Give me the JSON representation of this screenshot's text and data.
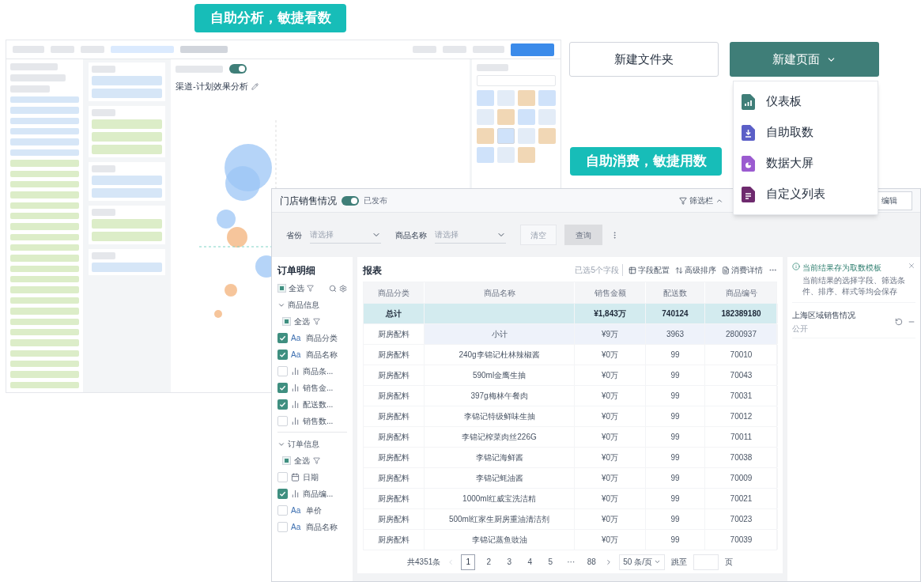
{
  "badges": [
    {
      "label": "自助分析，敏捷看数"
    },
    {
      "label": "自助消费，敏捷用数"
    }
  ],
  "editor": {
    "title": "渠道-计划效果分析",
    "toggle_on": true
  },
  "actions": {
    "folder_button": "新建文件夹",
    "page_button": "新建页面",
    "menu_open": true,
    "menu": [
      {
        "label": "仪表板",
        "color": "#3f7e78",
        "kind": "chart"
      },
      {
        "label": "自助取数",
        "color": "#5b5fc7",
        "kind": "download"
      },
      {
        "label": "数据大屏",
        "color": "#9b5bd0",
        "kind": "pie"
      },
      {
        "label": "自定义列表",
        "color": "#6e2a6e",
        "kind": "list"
      }
    ]
  },
  "report_window": {
    "title": "门店销售情况",
    "published": true,
    "status": "已发布",
    "filter_toggle": "筛选栏",
    "edit_button": "编辑",
    "filters": [
      {
        "label": "省份",
        "placeholder": "请选择"
      },
      {
        "label": "商品名称",
        "placeholder": "请选择"
      }
    ],
    "clear_button": "清空",
    "query_button": "查询",
    "field_panel": {
      "title": "订单明细",
      "select_all": {
        "label": "全选",
        "indeterminate": true
      },
      "groups": [
        {
          "label": "商品信息",
          "expanded": true,
          "select_all": {
            "label": "全选",
            "indeterminate": true
          },
          "fields": [
            {
              "kind": "text",
              "icon_text": "Aa",
              "label": "商品分类",
              "checked": true
            },
            {
              "kind": "text",
              "icon_text": "Aa",
              "label": "商品名称",
              "checked": true
            },
            {
              "kind": "measure",
              "label": "商品条...",
              "checked": false
            },
            {
              "kind": "measure",
              "label": "销售金...",
              "checked": true
            },
            {
              "kind": "measure",
              "label": "配送数...",
              "checked": true
            },
            {
              "kind": "measure",
              "label": "销售数...",
              "checked": false
            }
          ]
        },
        {
          "label": "订单信息",
          "expanded": true,
          "select_all": {
            "label": "全选",
            "indeterminate": true
          },
          "fields": [
            {
              "kind": "date",
              "label": "日期",
              "checked": false
            },
            {
              "kind": "measure",
              "label": "商品编...",
              "checked": true
            },
            {
              "kind": "text",
              "icon_text": "Aa",
              "label": "单价",
              "checked": false
            },
            {
              "kind": "text",
              "icon_text": "Aa",
              "label": "商品名称",
              "checked": false
            }
          ]
        }
      ]
    },
    "report": {
      "title": "报表",
      "selected_count": "已选5个字段",
      "tools": [
        "字段配置",
        "高级排序",
        "消费详情"
      ],
      "columns": [
        "商品分类",
        "商品名称",
        "销售金额",
        "配送数",
        "商品编号"
      ],
      "rows": [
        {
          "kind": "total",
          "cells": [
            "总计",
            "",
            "¥1,843万",
            "740124",
            "182389180"
          ]
        },
        {
          "kind": "subtotal",
          "cells": [
            "厨房配料",
            "小计",
            "¥9万",
            "3963",
            "2800937"
          ]
        },
        {
          "kind": "row",
          "cells": [
            "厨房配料",
            "240g李锦记杜林辣椒酱",
            "¥0万",
            "99",
            "70010"
          ]
        },
        {
          "kind": "row",
          "cells": [
            "厨房配料",
            "590ml金鹰生抽",
            "¥0万",
            "99",
            "70043"
          ]
        },
        {
          "kind": "row",
          "cells": [
            "厨房配料",
            "397g梅林午餐肉",
            "¥0万",
            "99",
            "70031"
          ]
        },
        {
          "kind": "row",
          "cells": [
            "厨房配料",
            "李锦记特级鲜味生抽",
            "¥0万",
            "99",
            "70012"
          ]
        },
        {
          "kind": "row",
          "cells": [
            "厨房配料",
            "李锦记榨菜肉丝226G",
            "¥0万",
            "99",
            "70011"
          ]
        },
        {
          "kind": "row",
          "cells": [
            "厨房配料",
            "李锦记海鲜酱",
            "¥0万",
            "99",
            "70038"
          ]
        },
        {
          "kind": "row",
          "cells": [
            "厨房配料",
            "李锦记蚝油酱",
            "¥0万",
            "99",
            "70009"
          ]
        },
        {
          "kind": "row",
          "cells": [
            "厨房配料",
            "1000ml红威宝洗洁精",
            "¥0万",
            "99",
            "70021"
          ]
        },
        {
          "kind": "row",
          "cells": [
            "厨房配料",
            "500ml红家生厨房重油清洁剂",
            "¥0万",
            "99",
            "70023"
          ]
        },
        {
          "kind": "row",
          "cells": [
            "厨房配料",
            "李锦记蒸鱼豉油",
            "¥0万",
            "99",
            "70039"
          ]
        }
      ],
      "pagination": {
        "total": "共4351条",
        "pages": [
          {
            "label": "1",
            "selected": true
          },
          {
            "label": "2",
            "selected": false
          },
          {
            "label": "3",
            "selected": false
          },
          {
            "label": "4",
            "selected": false
          },
          {
            "label": "5",
            "selected": false
          },
          {
            "label": "···",
            "selected": false
          },
          {
            "label": "88",
            "selected": false
          }
        ],
        "page_size": "50 条/页",
        "jump_label": "跳至",
        "jump_suffix": "页"
      }
    },
    "side": {
      "notice_title": "当前结果存为取数模板",
      "notice_body": "当前结果的选择字段、筛选条件、排序、样式等均会保存",
      "template_name": "上海区域销售情况",
      "template_scope": "公开"
    }
  }
}
